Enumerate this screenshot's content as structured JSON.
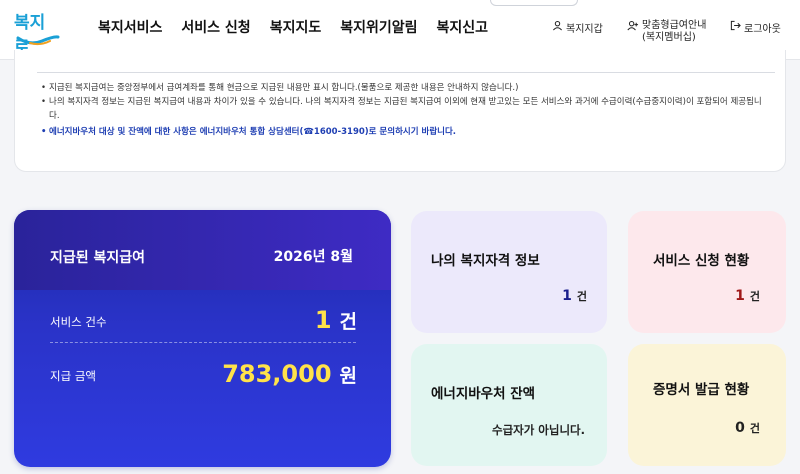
{
  "header": {
    "logo_text": "복지로",
    "nav": [
      "복지서비스",
      "서비스 신청",
      "복지지도",
      "복지위기알림",
      "복지신고"
    ],
    "util": {
      "wallet": "복지지갑",
      "benefit_line1": "맞춤형급여안내",
      "benefit_line2": "(복지멤버십)",
      "logout": "로그아웃"
    }
  },
  "notice": {
    "items": [
      "지급된 복지급여는 중앙정부에서 급여계좌를 통해 현금으로 지급된 내용만 표시 합니다.(물품으로 제공한 내용은 안내하지 않습니다.)",
      "나의 복지자격 정보는 지급된 복지급여 내용과 차이가 있을 수 있습니다. 나의 복지자격 정보는 지급된 복지급여 이외에 현재 받고있는 모든 서비스와 과거에 수급이력(수급중지이력)이 포함되어 제공됩니다."
    ],
    "highlight": "에너지바우처 대상 및 잔액에 대한 사항은 에너지바우처 통합 상담센터(☎1600-3190)로 문의하시기 바랍니다."
  },
  "paid": {
    "title": "지급된 복지급여",
    "date": "2026년  8월",
    "service_count_label": "서비스 건수",
    "service_count": "1",
    "service_count_unit": "건",
    "amount_label": "지급 금액",
    "amount": "783,000",
    "amount_unit": "원"
  },
  "cards": {
    "eligibility": {
      "title": "나의 복지자격 정보",
      "value": "1",
      "unit": "건",
      "bg": "#ece9fb",
      "value_color": "#1a1f8c"
    },
    "application": {
      "title": "서비스 신청 현황",
      "value": "1",
      "unit": "건",
      "bg": "#fde8ec",
      "value_color": "#a01818"
    },
    "voucher": {
      "title": "에너지바우처 잔액",
      "status": "수급자가 아닙니다.",
      "bg": "#e2f6f1"
    },
    "certificate": {
      "title": "증명서 발급 현황",
      "value": "0",
      "unit": "건",
      "bg": "#fbf4d8",
      "value_color": "#222"
    }
  }
}
